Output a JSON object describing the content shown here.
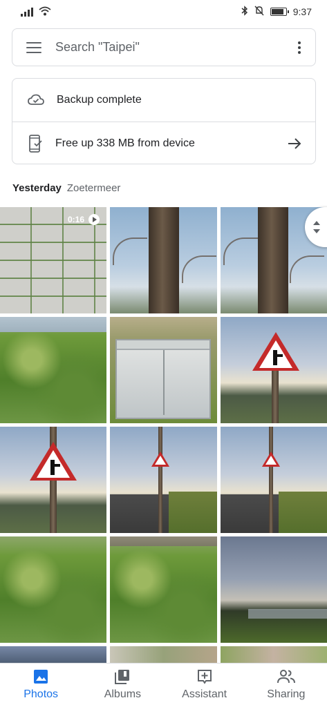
{
  "status_bar": {
    "time": "9:37"
  },
  "search": {
    "placeholder": "Search \"Taipei\""
  },
  "card": {
    "backup_label": "Backup complete",
    "free_up_label": "Free up 338 MB from device"
  },
  "section": {
    "date": "Yesterday",
    "place": "Zoetermeer"
  },
  "grid": {
    "video_duration": "0:16"
  },
  "bottom_nav": {
    "items": [
      {
        "label": "Photos",
        "icon": "photos-icon",
        "active": true
      },
      {
        "label": "Albums",
        "icon": "albums-icon",
        "active": false
      },
      {
        "label": "Assistant",
        "icon": "assistant-icon",
        "active": false
      },
      {
        "label": "Sharing",
        "icon": "sharing-icon",
        "active": false
      }
    ]
  },
  "colors": {
    "accent": "#1a73e8",
    "text": "#202124",
    "muted": "#5f6368",
    "border": "#dadce0"
  }
}
